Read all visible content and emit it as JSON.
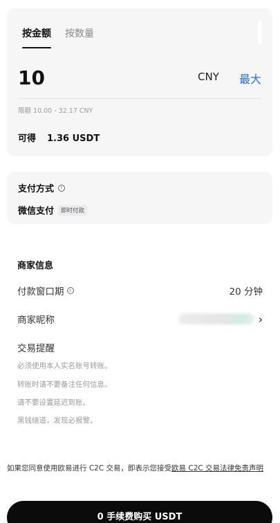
{
  "amount_card": {
    "tabs": [
      {
        "label": "按金额",
        "active": true
      },
      {
        "label": "按数量",
        "active": false
      }
    ],
    "amount_value": "10",
    "currency": "CNY",
    "max_label": "最大",
    "limit_text": "限额 10.00 - 32.17 CNY",
    "receive_label": "可得",
    "receive_value": "1.36 USDT"
  },
  "payment": {
    "title": "支付方式",
    "info_icon": "info-icon",
    "method": "微信支付",
    "method_badge": "即时付款"
  },
  "merchant": {
    "title": "商家信息",
    "payment_window_label": "付款窗口期",
    "payment_window_value": "20 分钟",
    "nickname_label": "商家昵称",
    "reminder_title": "交易提醒",
    "reminders": [
      "必须使用本人实名账号转账。",
      "转账时请不要备注任何信息。",
      "请不要设置延迟到账。",
      "黑钱绕道，发现必报警。"
    ]
  },
  "agreement": {
    "text_before": "如果您同意使用欧易进行 C2C 交易，即表示您接受",
    "link_text": "欧易 C2C 交易法律免责声明"
  },
  "buy_button_label": "0 手续费购买 USDT",
  "colors": {
    "accent": "#1e6ff0",
    "card_bg": "#f6f6f7",
    "button_bg": "#0b0b0c"
  }
}
